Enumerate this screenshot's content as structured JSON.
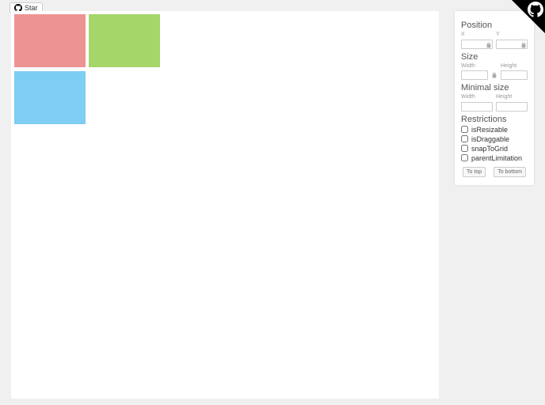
{
  "corner": {
    "icon": "octocat"
  },
  "star": {
    "label": "Star"
  },
  "panel": {
    "position": {
      "title": "Position",
      "x_label": "X",
      "y_label": "Y",
      "x": "",
      "y": ""
    },
    "size": {
      "title": "Size",
      "w_label": "Width",
      "h_label": "Height",
      "w": "",
      "h": ""
    },
    "minsize": {
      "title": "Minimal size",
      "w_label": "Width",
      "h_label": "Height",
      "w": "",
      "h": ""
    },
    "restrictions": {
      "title": "Restrictions",
      "isResizable": "isResizable",
      "isDraggable": "isDraggable",
      "snapToGrid": "snapToGrid",
      "parentLimitation": "parentLimitation"
    },
    "buttons": {
      "toTop": "To top",
      "toBottom": "To bottom"
    }
  },
  "boxes": {
    "red": {
      "color": "#ee9393"
    },
    "green": {
      "color": "#a5d66a"
    },
    "blue": {
      "color": "#7ecdf2"
    }
  }
}
